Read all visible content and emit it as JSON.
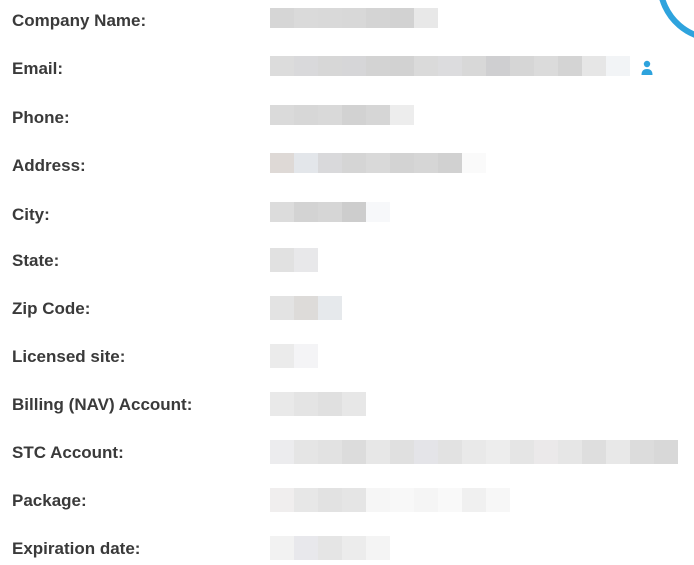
{
  "fields": [
    {
      "key": "company",
      "label": "Company Name:"
    },
    {
      "key": "email",
      "label": "Email:"
    },
    {
      "key": "phone",
      "label": "Phone:"
    },
    {
      "key": "address",
      "label": "Address:"
    },
    {
      "key": "city",
      "label": "City:"
    },
    {
      "key": "state",
      "label": "State:"
    },
    {
      "key": "zip",
      "label": "Zip Code:"
    },
    {
      "key": "licensed_site",
      "label": "Licensed site:"
    },
    {
      "key": "billing_account",
      "label": "Billing (NAV) Account:"
    },
    {
      "key": "stc_account",
      "label": "STC Account:"
    },
    {
      "key": "package",
      "label": "Package:"
    },
    {
      "key": "expiration",
      "label": "Expiration date:"
    }
  ],
  "icons": {
    "contact": "user-icon",
    "loader": "spinner-ring-icon"
  },
  "colors": {
    "label_text": "#3a3a3a",
    "accent": "#2ea3dd",
    "redacted_light": "#eeeeee",
    "redacted_dark": "#cfcfcf"
  }
}
